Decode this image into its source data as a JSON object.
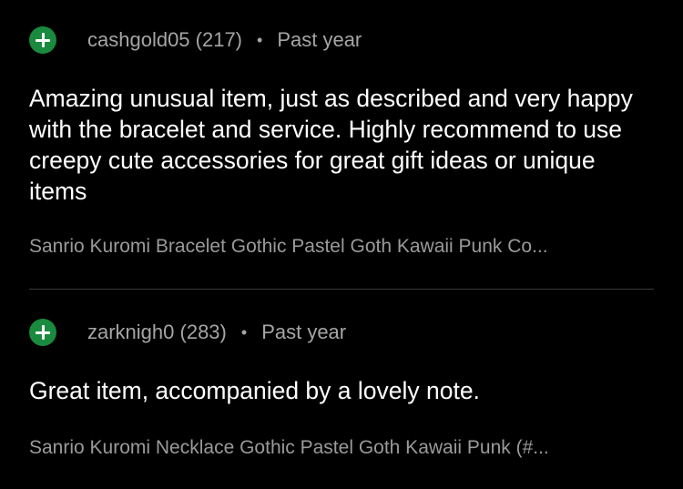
{
  "reviews": [
    {
      "rating_icon": "plus-circle-icon",
      "username": "cashgold05 (217)",
      "separator": "•",
      "timestamp": "Past year",
      "text": "Amazing unusual item, just as described and very happy with the bracelet and service. Highly recommend to use creepy cute accessories for great gift ideas or unique items",
      "item_title": "Sanrio Kuromi Bracelet Gothic Pastel Goth Kawaii Punk Co..."
    },
    {
      "rating_icon": "plus-circle-icon",
      "username": "zarknigh0 (283)",
      "separator": "•",
      "timestamp": "Past year",
      "text": "Great item, accompanied by a lovely note.",
      "item_title": "Sanrio Kuromi Necklace Gothic Pastel Goth Kawaii Punk (#..."
    }
  ],
  "colors": {
    "background": "#000000",
    "positive_icon": "#1a8a3f",
    "secondary_text": "#a5a5a5",
    "divider": "#3a3a3a"
  }
}
